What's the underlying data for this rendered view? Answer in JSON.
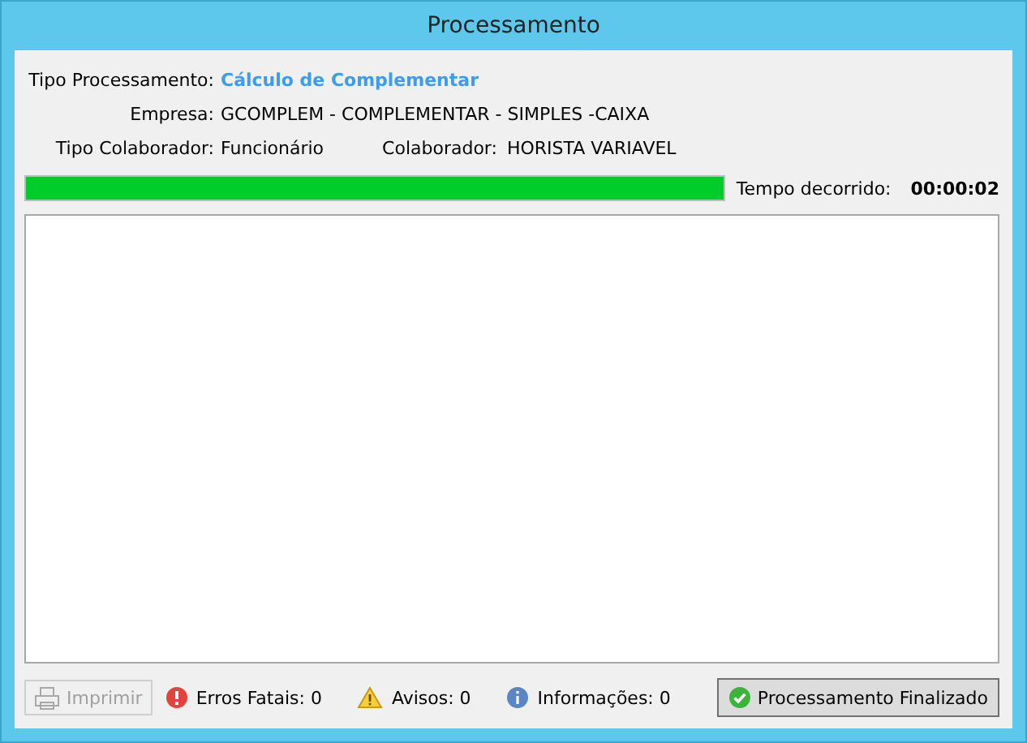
{
  "window": {
    "title": "Processamento"
  },
  "fields": [
    {
      "label": "Tipo Processamento:",
      "value": "Cálculo de Complementar",
      "kind": "highlight"
    },
    {
      "label": "Empresa:",
      "value": "GCOMPLEM - COMPLEMENTAR - SIMPLES -CAIXA",
      "kind": "plain"
    }
  ],
  "colaborador": {
    "tipo_label": "Tipo Colaborador:",
    "tipo_value": "Funcionário",
    "label": "Colaborador:",
    "value": "HORISTA  VARIAVEL"
  },
  "progress": {
    "level": 1,
    "elapsed_label": "Tempo decorrido:",
    "elapsed_value": "00:00:02"
  },
  "footer": {
    "print_button": {
      "label": "Imprimir",
      "disabled": true
    },
    "counters": [
      {
        "kind": "error",
        "label": "Erros Fatais: 0"
      },
      {
        "kind": "warning",
        "label": "Avisos: 0"
      },
      {
        "kind": "info",
        "label": "Informações: 0"
      }
    ],
    "status_button": {
      "label": "Processamento Finalizado"
    }
  }
}
